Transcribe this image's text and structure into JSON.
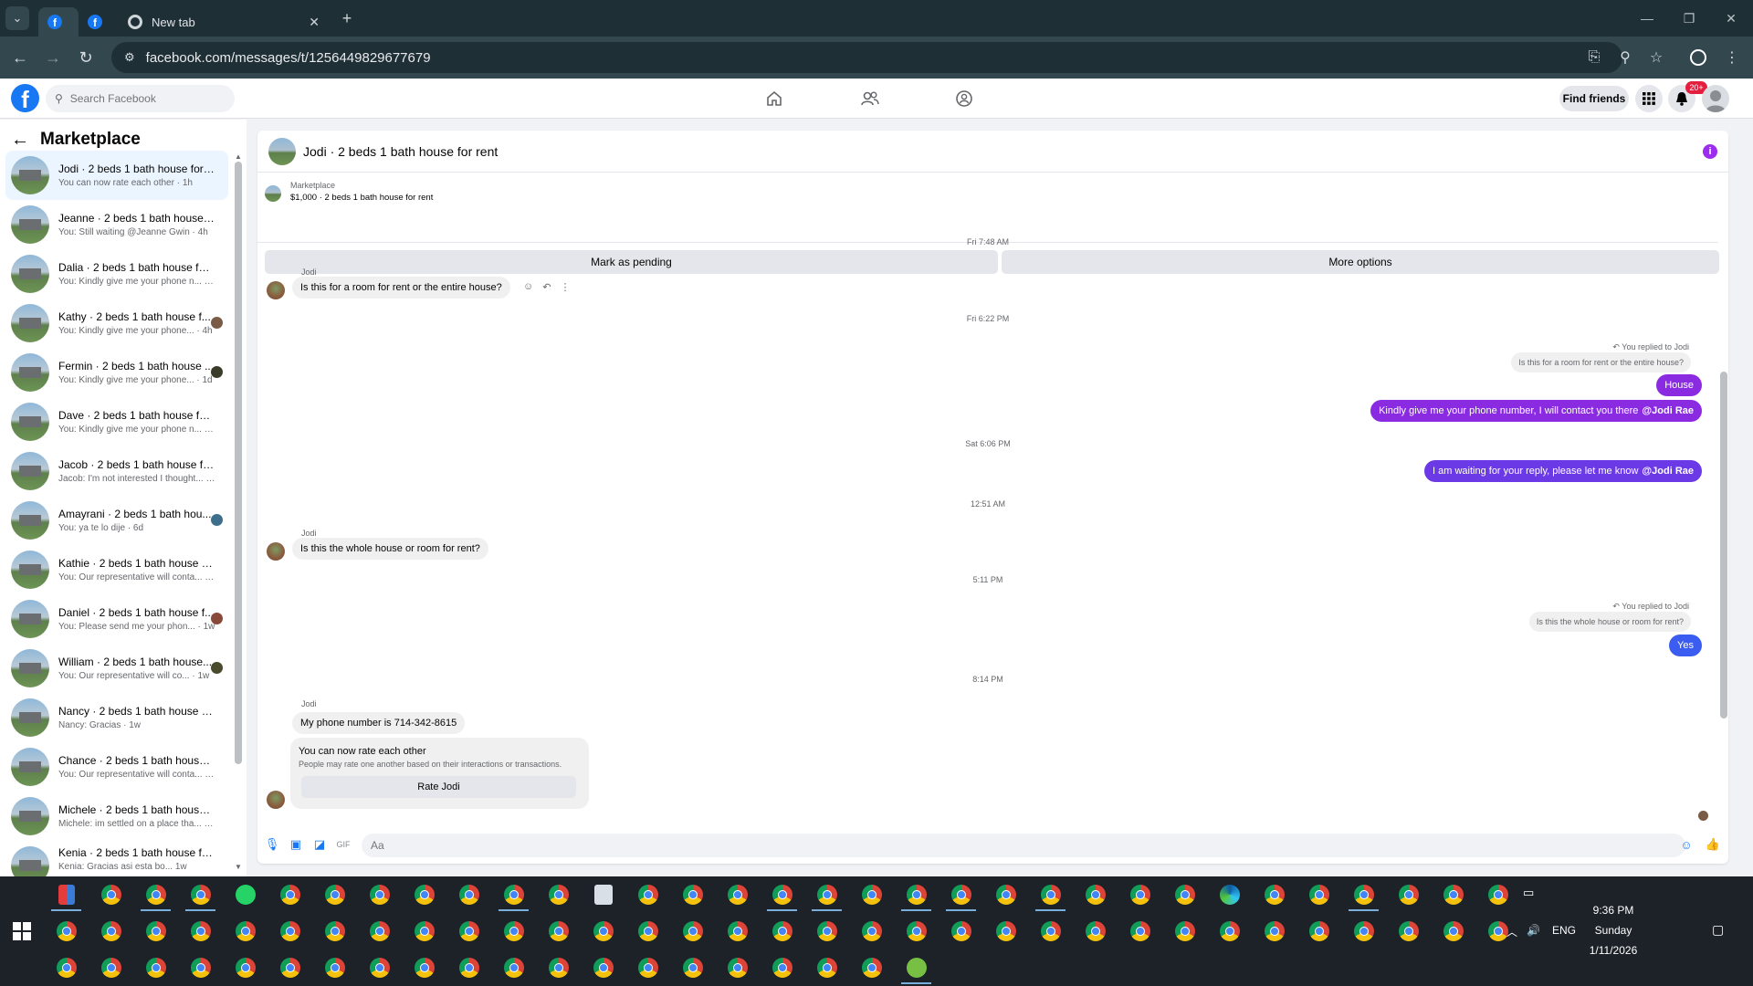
{
  "browser": {
    "tabs": [
      {
        "title": "",
        "icon": "facebook-icon"
      },
      {
        "title": "",
        "icon": "facebook-icon"
      },
      {
        "title": "New tab",
        "icon": "chrome-icon"
      }
    ],
    "url": "facebook.com/messages/t/1256449829677679"
  },
  "fb_header": {
    "search_placeholder": "Search Facebook",
    "find_friends": "Find friends",
    "notification_count": "20+"
  },
  "sidebar": {
    "title": "Marketplace",
    "conversations": [
      {
        "name": "Jodi · 2 beds 1 bath house for r...",
        "preview": "You can now rate each other · 1h",
        "active": true
      },
      {
        "name": "Jeanne · 2 beds 1 bath house fo...",
        "preview": "You: Still waiting @Jeanne Gwin · 4h"
      },
      {
        "name": "Dalia · 2 beds 1 bath house for r...",
        "preview": "You: Kindly give me your phone n... · 4h"
      },
      {
        "name": "Kathy · 2 beds 1 bath house f...",
        "preview": "You: Kindly give me your phone... · 4h"
      },
      {
        "name": "Fermin · 2 beds 1 bath house ...",
        "preview": "You: Kindly give me your phone... · 1d"
      },
      {
        "name": "Dave · 2 beds 1 bath house for r...",
        "preview": "You: Kindly give me your phone n... · 1d"
      },
      {
        "name": "Jacob · 2 beds 1 bath house for ...",
        "preview": "Jacob: I'm not interested I thought... · 5d"
      },
      {
        "name": "Amayrani · 2 beds 1 bath hou...",
        "preview": "You: ya te lo dije · 6d"
      },
      {
        "name": "Kathie · 2 beds 1 bath house for...",
        "preview": "You: Our representative will conta... · 1w"
      },
      {
        "name": "Daniel · 2 beds 1 bath house f...",
        "preview": "You: Please send me your phon... · 1w"
      },
      {
        "name": "William · 2 beds 1 bath house...",
        "preview": "You: Our representative will co... · 1w"
      },
      {
        "name": "Nancy · 2 beds 1 bath house for...",
        "preview": "Nancy: Gracias · 1w"
      },
      {
        "name": "Chance · 2 beds 1 bath house fo...",
        "preview": "You: Our representative will conta... · 1w"
      },
      {
        "name": "Michele · 2 beds 1 bath house f...",
        "preview": "Michele: im settled on a place tha... · 1w"
      },
      {
        "name": "Kenia · 2 beds 1 bath house for ...",
        "preview": "Kenia: Gracias asi esta bo... 1w"
      }
    ]
  },
  "chat": {
    "title": "Jodi · 2 beds 1 bath house for rent",
    "marketplace_label": "Marketplace",
    "listing": "$1,000 · 2 beds 1 bath house for rent",
    "mark_pending": "Mark as pending",
    "more_options": "More options",
    "top_timestamp": "Fri 7:48 AM",
    "ts1": "Fri 6:22 PM",
    "ts2": "Sat 6:06 PM",
    "ts3": "12:51 AM",
    "ts4": "5:11 PM",
    "ts5": "8:14 PM",
    "sender": "Jodi",
    "msg1": "Is this for a room for rent or the entire house?",
    "reply_note": "You replied to Jodi",
    "reply_quote1": "Is this for a room for rent or the entire house?",
    "out1": "House",
    "out2_text": "Kindly give me your phone number, I will contact you there",
    "out2_mention": "@Jodi Rae",
    "out3_text": "I am waiting for your reply, please let me know",
    "out3_mention": "@Jodi Rae",
    "msg2": "Is this the whole house or room for rent?",
    "reply_quote2": "Is this the whole house or room for rent?",
    "out4": "Yes",
    "msg3": "My phone number is 714-342-8615",
    "rate_title": "You can now rate each other",
    "rate_sub": "People may rate one another based on their interactions or transactions.",
    "rate_button": "Rate Jodi",
    "input_placeholder": "Aa"
  },
  "colors": {
    "fb_blue": "#1877f2",
    "bubble_purple": "#8a2be2",
    "bubble_blue": "#3b5cf0",
    "info_purple": "#9b2cf0"
  },
  "taskbar": {
    "time": "9:36 PM",
    "day": "Sunday",
    "date": "1/11/2026",
    "language": "ENG"
  }
}
